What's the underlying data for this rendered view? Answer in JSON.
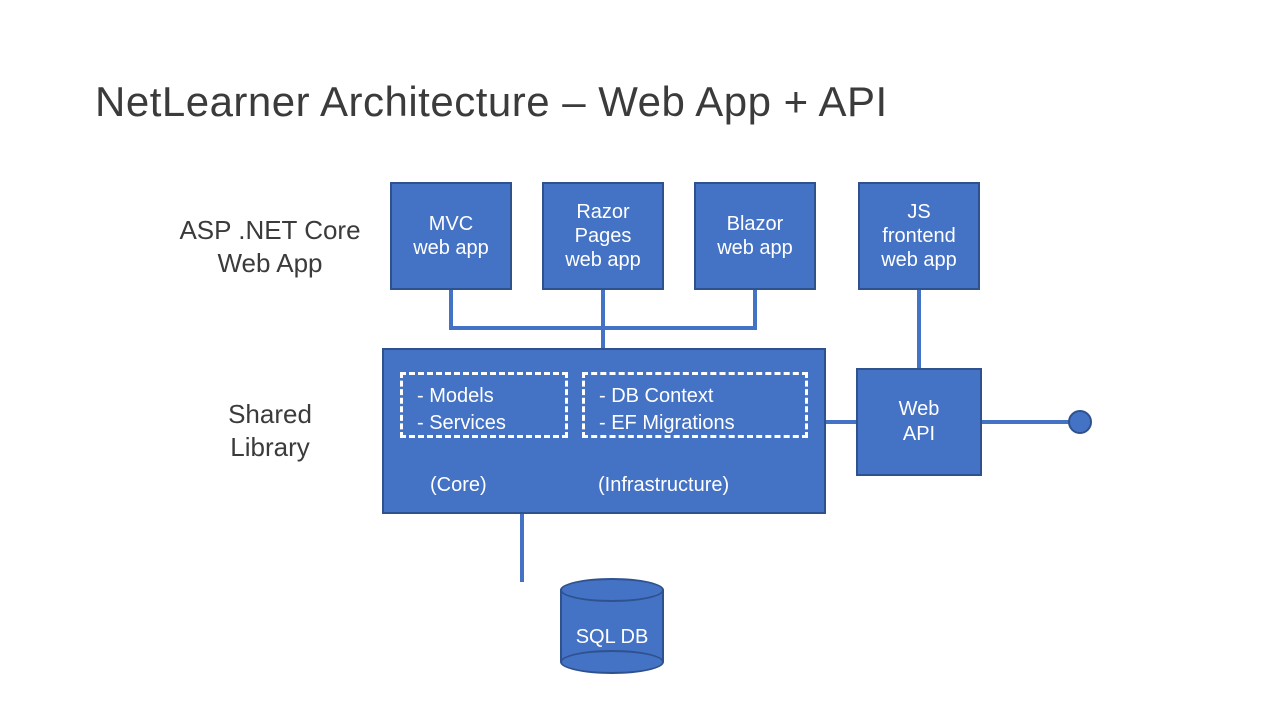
{
  "title": "NetLearner Architecture – Web App + API",
  "labels": {
    "row1": "ASP .NET Core\nWeb App",
    "row2": "Shared\nLibrary"
  },
  "top_boxes": {
    "mvc": "MVC\nweb app",
    "razor": "Razor\nPages\nweb app",
    "blazor": "Blazor\nweb app",
    "js": "JS\nfrontend\nweb app"
  },
  "shared": {
    "core_lines": "-   Models\n-   Services",
    "infra_lines": "-   DB Context\n-   EF Migrations",
    "core_label": "(Core)",
    "infra_label": "(Infrastructure)"
  },
  "web_api": "Web\nAPI",
  "db": "SQL DB",
  "colors": {
    "primary": "#4472c4",
    "border": "#2f528f"
  }
}
